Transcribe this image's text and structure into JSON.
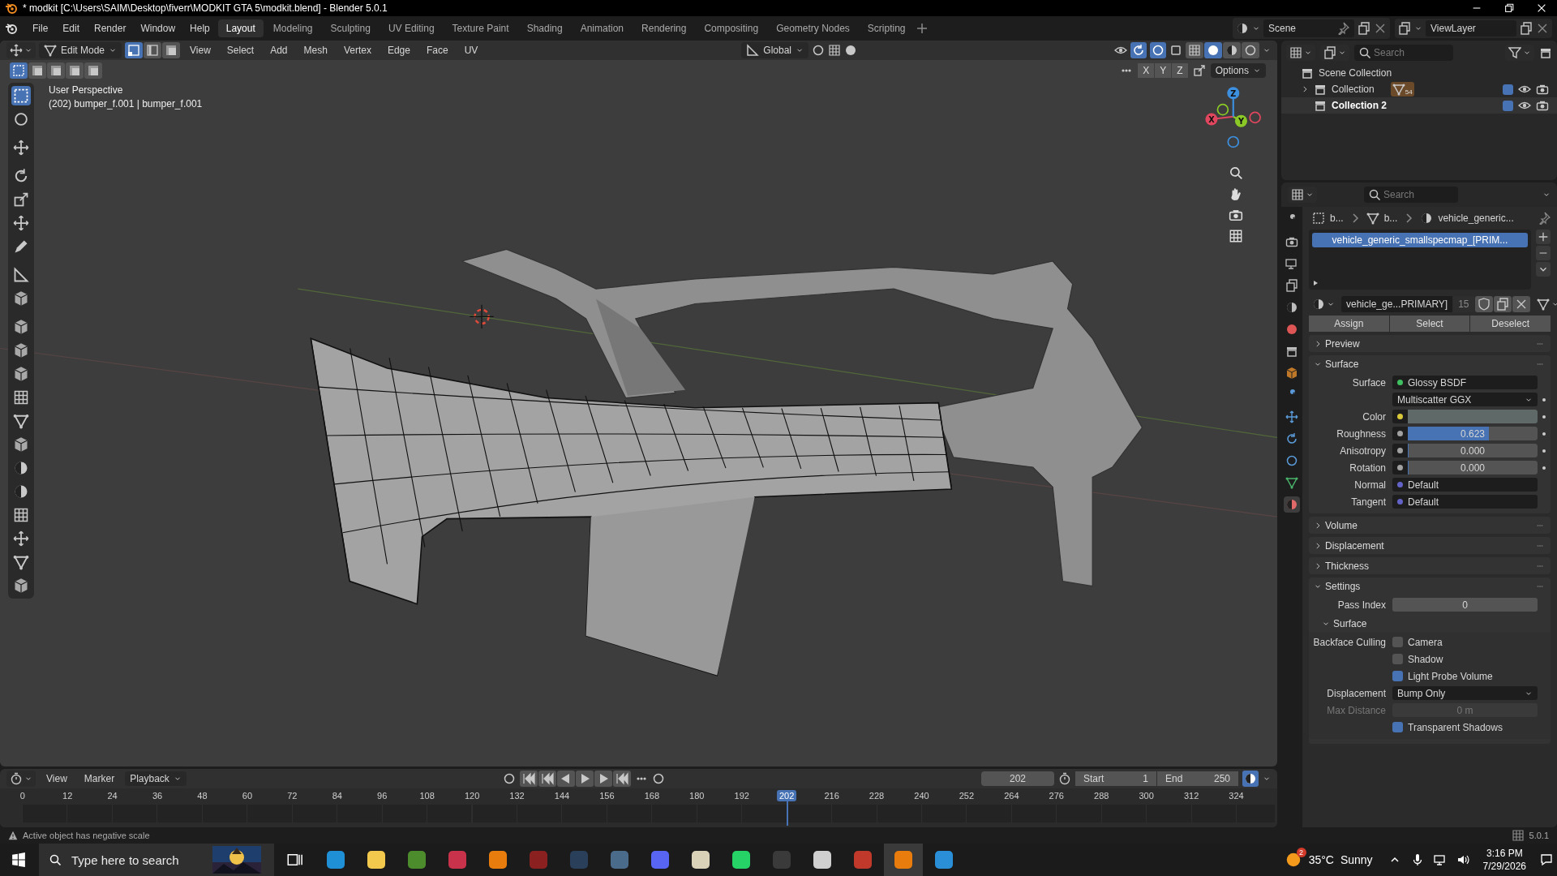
{
  "window": {
    "title": "* modkit [C:\\Users\\SAIM\\Desktop\\fiverr\\MODKIT GTA 5\\modkit.blend] - Blender 5.0.1"
  },
  "menu": [
    "File",
    "Edit",
    "Render",
    "Window",
    "Help"
  ],
  "workspaces": [
    {
      "label": "Layout",
      "selected": true
    },
    {
      "label": "Modeling",
      "selected": false
    },
    {
      "label": "Sculpting",
      "selected": false
    },
    {
      "label": "UV Editing",
      "selected": false
    },
    {
      "label": "Texture Paint",
      "selected": false
    },
    {
      "label": "Shading",
      "selected": false
    },
    {
      "label": "Animation",
      "selected": false
    },
    {
      "label": "Rendering",
      "selected": false
    },
    {
      "label": "Compositing",
      "selected": false
    },
    {
      "label": "Geometry Nodes",
      "selected": false
    },
    {
      "label": "Scripting",
      "selected": false
    }
  ],
  "scene": {
    "name": "Scene",
    "view_layer": "ViewLayer"
  },
  "viewport": {
    "mode": "Edit Mode",
    "select_modes": [
      {
        "selected": true
      },
      {
        "selected": false
      },
      {
        "selected": false
      }
    ],
    "menus": [
      "View",
      "Select",
      "Add",
      "Mesh",
      "Vertex",
      "Edge",
      "Face",
      "UV"
    ],
    "orientation": "Global",
    "shading_modes": [
      {
        "selected": false
      },
      {
        "selected": true
      },
      {
        "selected": false
      },
      {
        "selected": false
      }
    ],
    "box_modes": [
      {
        "selected": true
      },
      {
        "selected": false
      },
      {
        "selected": false
      },
      {
        "selected": false
      },
      {
        "selected": false
      }
    ],
    "mirror_axes": [
      "X",
      "Y",
      "Z"
    ],
    "options": "Options",
    "view_name": "User Perspective",
    "object_info": "(202) bumper_f.001 | bumper_f.001",
    "gizmo_axes": [
      {
        "label": "X",
        "color": "#e0465e"
      },
      {
        "label": "Y",
        "color": "#8ac926"
      },
      {
        "label": "Z",
        "color": "#3d8fe0"
      }
    ],
    "tools": [
      {
        "selected": true
      },
      {
        "selected": false
      },
      {
        "selected": false
      },
      {
        "selected": false
      },
      {
        "selected": false
      },
      {
        "selected": false
      },
      {
        "selected": false
      },
      {
        "selected": false
      },
      {
        "selected": false
      },
      {
        "selected": false
      },
      {
        "selected": false
      },
      {
        "selected": false
      },
      {
        "selected": false
      },
      {
        "selected": false
      },
      {
        "selected": false
      },
      {
        "selected": false
      },
      {
        "selected": false
      },
      {
        "selected": false
      },
      {
        "selected": false
      },
      {
        "selected": false
      },
      {
        "selected": false
      }
    ]
  },
  "outliner": {
    "search_placeholder": "Search",
    "items": [
      {
        "label": "Scene Collection",
        "children": [
          {
            "label": "Collection",
            "expanded": false,
            "badge": "54",
            "checked": true,
            "selected": false
          },
          {
            "label": "Collection 2",
            "checked": true,
            "selected": true
          }
        ]
      }
    ]
  },
  "properties": {
    "search_placeholder": "Search",
    "tabs": [
      {
        "selected": false
      },
      {
        "selected": false
      },
      {
        "selected": false
      },
      {
        "selected": false
      },
      {
        "selected": false
      },
      {
        "selected": false
      },
      {
        "selected": false
      },
      {
        "selected": false
      },
      {
        "selected": false
      },
      {
        "selected": false
      },
      {
        "selected": false
      },
      {
        "selected": false
      },
      {
        "selected": false
      },
      {
        "selected": true
      }
    ],
    "breadcrumb": [
      "b...",
      "b...",
      "vehicle_generic..."
    ],
    "slots": [
      {
        "label": "vehicle_generic_smallspecmap_[PRIM...",
        "selected": true
      }
    ],
    "material": {
      "name": "vehicle_ge...PRIMARY]",
      "users": "15"
    },
    "actions": [
      "Assign",
      "Select",
      "Deselect"
    ],
    "panels": [
      {
        "title": "Preview",
        "expanded": false
      },
      {
        "title": "Surface",
        "expanded": true,
        "rows": [
          {
            "kind": "link",
            "label": "Surface",
            "value": "Glossy BSDF",
            "color": "#3fbf5f",
            "animatable": false
          },
          {
            "kind": "enum",
            "value": "Multiscatter GGX",
            "animatable": true
          },
          {
            "kind": "color",
            "label": "Color",
            "color": "#d8c83a",
            "animatable": true
          },
          {
            "kind": "slider",
            "label": "Roughness",
            "value": "0.623",
            "level": 0.623,
            "color": "#a1a1a1",
            "animatable": true
          },
          {
            "kind": "slider",
            "label": "Anisotropy",
            "value": "0.000",
            "level": 0,
            "color": "#a1a1a1",
            "animatable": true
          },
          {
            "kind": "slider",
            "label": "Rotation",
            "value": "0.000",
            "level": 0,
            "color": "#a1a1a1",
            "animatable": true
          },
          {
            "kind": "link",
            "label": "Normal",
            "value": "Default",
            "color": "#6363c7",
            "animatable": false
          },
          {
            "kind": "link",
            "label": "Tangent",
            "value": "Default",
            "color": "#6363c7",
            "animatable": false
          }
        ]
      },
      {
        "title": "Volume",
        "expanded": false
      },
      {
        "title": "Displacement",
        "expanded": false
      },
      {
        "title": "Thickness",
        "expanded": false
      },
      {
        "title": "Settings",
        "expanded": true,
        "rows": [
          {
            "kind": "field",
            "label": "Pass Index",
            "value": "0",
            "disabled": false
          }
        ],
        "subpanels": [
          {
            "title": "Surface",
            "expanded": true,
            "rows": [
              {
                "kind": "checkbox",
                "label": "Backface Culling",
                "text": "Camera",
                "checked": false
              },
              {
                "kind": "checkbox",
                "text": "Shadow",
                "checked": false
              },
              {
                "kind": "checkbox",
                "text": "Light Probe Volume",
                "checked": true
              },
              {
                "kind": "enum",
                "label": "Displacement",
                "value": "Bump Only"
              },
              {
                "kind": "field",
                "label": "Max Distance",
                "value": "0 m",
                "disabled": true
              },
              {
                "kind": "checkbox",
                "text": "Transparent Shadows",
                "checked": true
              }
            ]
          }
        ]
      }
    ]
  },
  "timeline": {
    "menus": [
      "View",
      "Marker",
      "Playback"
    ],
    "frame": "202",
    "start_label": "Start",
    "start": "1",
    "end_label": "End",
    "end": "250",
    "ticks_before": [
      "0",
      "12",
      "24",
      "36",
      "48",
      "60",
      "72",
      "84",
      "96",
      "108",
      "120",
      "132",
      "144",
      "156",
      "168",
      "180",
      "192"
    ],
    "current": "202",
    "ticks_after": [
      "216",
      "228",
      "240",
      "252",
      "264",
      "276",
      "288",
      "300",
      "312",
      "324"
    ]
  },
  "status": {
    "message": "Active object has negative scale",
    "version": "5.0.1"
  },
  "taskbar": {
    "search_placeholder": "Type here to search",
    "apps": [
      {
        "color": "#1f8fd6",
        "selected": false
      },
      {
        "color": "#f2c94c",
        "selected": false
      },
      {
        "color": "#4c8c2c",
        "selected": false
      },
      {
        "color": "#c8324a",
        "selected": false
      },
      {
        "color": "#e87d0d",
        "selected": false
      },
      {
        "color": "#8b2020",
        "selected": false
      },
      {
        "color": "#2a3f5a",
        "selected": false
      },
      {
        "color": "#4b6b8a",
        "selected": false
      },
      {
        "color": "#5865f2",
        "selected": false
      },
      {
        "color": "#d9d2b8",
        "selected": false
      },
      {
        "color": "#25d366",
        "selected": false
      },
      {
        "color": "#3a3a3a",
        "selected": false
      },
      {
        "color": "#d0d0d0",
        "selected": false
      },
      {
        "color": "#c0392b",
        "selected": false
      },
      {
        "color": "#e87d0d",
        "selected": true
      },
      {
        "color": "#2a8fd6",
        "selected": false
      }
    ],
    "weather": {
      "badge": "2",
      "temp": "35°C",
      "condition": "Sunny"
    },
    "time": "3:16 PM",
    "date": "7/29/2026"
  }
}
